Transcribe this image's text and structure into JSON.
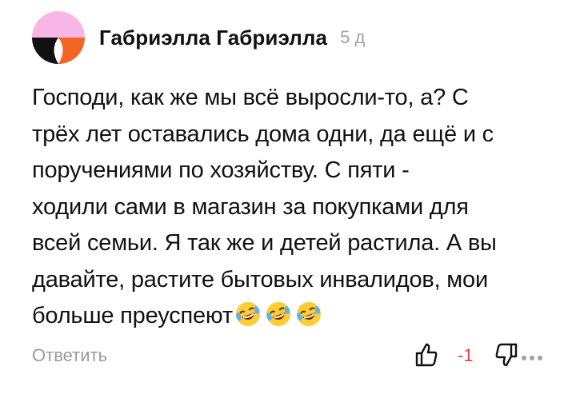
{
  "comment": {
    "author": "Габриэлла Габриэлла",
    "age": "5 д",
    "text_lines": [
      "Господи, как же мы всё выросли-то, а? С",
      "трёх лет оставались дома одни, да ещё и с",
      "поручениями по хозяйству. С пяти -",
      "ходили сами в магазин за покупками для",
      "всей семьи. Я так же и детей растила. А вы",
      "давайте, растите бытовых инвалидов, мои",
      "больше преуспеют"
    ],
    "emojis": [
      "rolling-on-floor-laughing-emoji",
      "rolling-on-floor-laughing-emoji",
      "rolling-on-floor-laughing-emoji"
    ],
    "actions": {
      "reply_label": "Ответить",
      "score": "-1",
      "like_icon": "thumbs-up-icon",
      "dislike_icon": "thumbs-down-icon",
      "more_icon": "more-dots-icon"
    },
    "colors": {
      "avatar_pink": "#f7b6e6",
      "avatar_black": "#111111",
      "avatar_orange": "#f26522",
      "score_negative": "#e0424a",
      "muted_gray": "#9a9a9a"
    }
  }
}
